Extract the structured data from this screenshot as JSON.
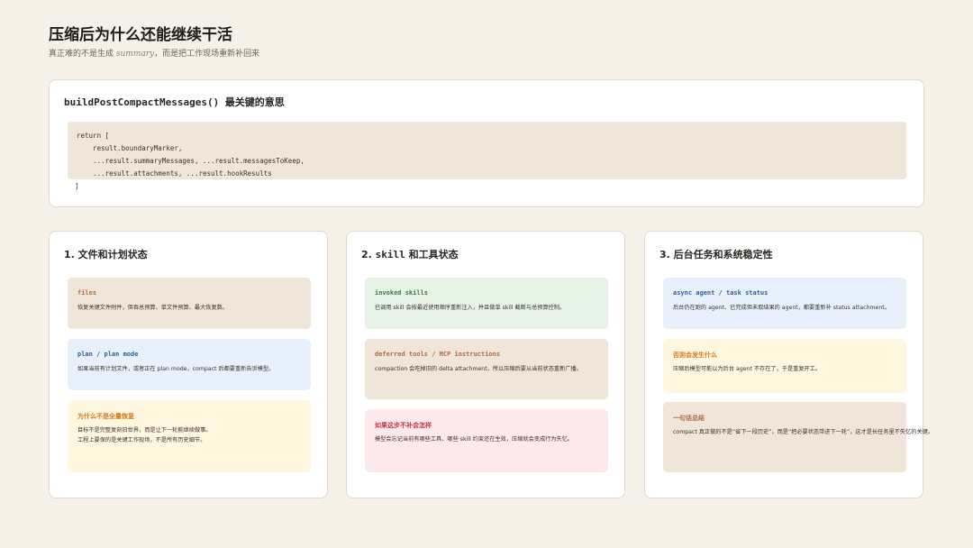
{
  "header": {
    "title": "压缩后为什么还能继续干活",
    "subtitle_pre": "真正难的不是生成 ",
    "subtitle_em": "summary",
    "subtitle_post": "，而是把工作现场重新补回来"
  },
  "code_panel": {
    "title": "buildPostCompactMessages() 最关键的意思",
    "lines": [
      "return [",
      "    result.boundaryMarker,",
      "    ...result.summaryMessages, ...result.messagesToKeep,",
      "    ...result.attachments, ...result.hookResults",
      "]"
    ]
  },
  "columns": [
    {
      "title_num": "1. ",
      "title_mono": "",
      "title_text": "文件和计划状态",
      "cards": [
        {
          "key": "files",
          "desc": [
            "恢复关键文件附件，但吞总预算、单文件预算、最大恢复数。"
          ]
        },
        {
          "key": "plan / plan mode",
          "desc": [
            "如果当前有计划文件，或者正在 plan mode，compact 后都要重新告诉模型。"
          ]
        },
        {
          "key": "为什么不是全量恢复",
          "desc": [
            "目标不是完整复刻旧世界，而是让下一轮能继续做事。",
            "工程上要保的是关键工作现场，不是所有历史细节。"
          ]
        }
      ]
    },
    {
      "title_num": "2. ",
      "title_mono": "skill",
      "title_text": " 和工具状态",
      "cards": [
        {
          "key": "invoked skills",
          "desc": [
            "已调用 skill 会按最近使用顺序重新注入，并且做单 skill 截断与总预算控制。"
          ]
        },
        {
          "key": "deferred tools / MCP instructions",
          "desc": [
            "compaction 会吃掉旧的 delta attachment，所以压缩后要从当前状态重新广播。"
          ]
        },
        {
          "key": "如果这步不补会怎样",
          "desc": [
            "模型会忘记当前有哪些工具、哪些 skill 约束还在生效，压缩就会变成行为失忆。"
          ]
        }
      ]
    },
    {
      "title_num": "3. ",
      "title_mono": "",
      "title_text": "后台任务和系统稳定性",
      "cards": [
        {
          "key": "async agent / task status",
          "desc": [
            "后台仍在跑的 agent、已完成但未取结果的 agent，都要重新补 status attachment。"
          ]
        },
        {
          "key": "否则会发生什么",
          "desc": [
            "压缩后模型可能以为后台 agent 不存在了，于是重复开工。"
          ]
        },
        {
          "key": "一句话总结",
          "desc": [
            "compact 真正做的不是“省下一段历史”，而是“把必要状态带进下一轮”，这才是长任务里不失忆的关键。"
          ]
        }
      ]
    }
  ]
}
